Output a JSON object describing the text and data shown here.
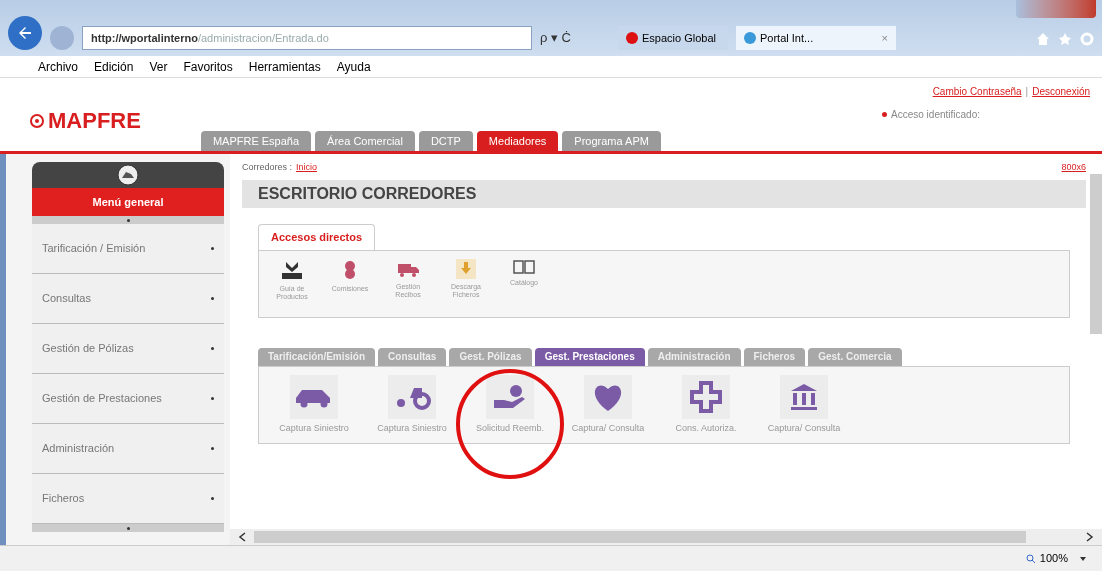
{
  "browser": {
    "url_host": "http://wportalinterno",
    "url_path": "/administracion/Entrada.do",
    "search_hint": "ρ ▾ Ċ",
    "tabs": [
      {
        "label": "Espacio Global",
        "selected": false
      },
      {
        "label": "Portal Int...",
        "selected": true
      }
    ],
    "tab_close": "×"
  },
  "menu_bar": [
    "Archivo",
    "Edición",
    "Ver",
    "Favoritos",
    "Herramientas",
    "Ayuda"
  ],
  "header": {
    "logo": "MAPFRE",
    "links": [
      "Cambio Contraseña",
      "Desconexión"
    ],
    "link_separator": "|",
    "status": "Acceso identificado:",
    "tabs": [
      {
        "label": "MAPFRE España",
        "selected": false
      },
      {
        "label": "Área Comercial",
        "selected": false
      },
      {
        "label": "DCTP",
        "selected": false
      },
      {
        "label": "Mediadores",
        "selected": true
      },
      {
        "label": "Programa APM",
        "selected": false
      }
    ]
  },
  "sidebar": {
    "title": "Menú general",
    "items": [
      "Tarificación / Emisión",
      "Consultas",
      "Gestión de Pólizas",
      "Gestión de Prestaciones",
      "Administración",
      "Ficheros"
    ]
  },
  "breadcrumb": {
    "label": "Corredores :",
    "link": "Inicio",
    "right_link": "800x6"
  },
  "page_title": "ESCRITORIO CORREDORES",
  "shortcuts": {
    "tab": "Accesos directos",
    "items": [
      {
        "label": "Guía de Productos",
        "kind": "tray"
      },
      {
        "label": "Comisiones",
        "kind": "coins"
      },
      {
        "label": "Gestión Recibos",
        "kind": "truck"
      },
      {
        "label": "Descarga Ficheros",
        "kind": "download"
      },
      {
        "label": "Catálogo",
        "kind": "book"
      }
    ]
  },
  "section_tabs": [
    {
      "label": "Tarificación/Emisión",
      "selected": false
    },
    {
      "label": "Consultas",
      "selected": false
    },
    {
      "label": "Gest. Pólizas",
      "selected": false
    },
    {
      "label": "Gest. Prestaciones",
      "selected": true
    },
    {
      "label": "Administración",
      "selected": false
    },
    {
      "label": "Ficheros",
      "selected": false
    },
    {
      "label": "Gest. Comercia",
      "selected": false
    }
  ],
  "section_items": [
    {
      "label": "Captura Siniestro",
      "kind": "car",
      "highlighted": false
    },
    {
      "label": "Captura Siniestro",
      "kind": "tractor",
      "highlighted": false
    },
    {
      "label": "Solicitud Reemb.",
      "kind": "hand",
      "highlighted": true
    },
    {
      "label": "Captura/ Consulta",
      "kind": "heart",
      "highlighted": false
    },
    {
      "label": "Cons. Autoriza.",
      "kind": "cross",
      "highlighted": false
    },
    {
      "label": "Captura/ Consulta",
      "kind": "bank",
      "highlighted": false
    }
  ],
  "status_bar": {
    "zoom": "100%"
  }
}
